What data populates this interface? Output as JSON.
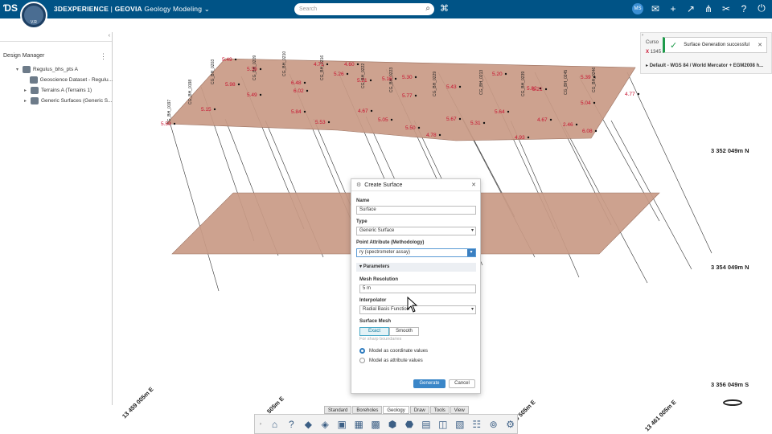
{
  "topbar": {
    "brand": "3DEXPERIENCE",
    "separator": " | ",
    "product": "GEOVIA",
    "app_name": "Geology Modeling",
    "search_placeholder": "Search",
    "compass_label": "V.R",
    "avatar_initials": "MS"
  },
  "left_panel": {
    "title": "Design Manager",
    "tree": [
      {
        "label": "Regulus_bhs_pts A"
      },
      {
        "label": "Geoscience Dataset - Regulu..."
      },
      {
        "label": "Terrains A (Terrains 1)"
      },
      {
        "label": "Generic Surfaces (Generic S..."
      }
    ]
  },
  "notifications": {
    "row1": "Curso",
    "row2_prefix": "X",
    "row2": "1345",
    "crs": "Default - WGS 84 / World Mercator + EGM2008 h...",
    "toast": "Surface Generation successful"
  },
  "dialog": {
    "title": "Create Surface",
    "name_label": "Name",
    "name_value": "Surface",
    "type_label": "Type",
    "type_value": "Generic Surface",
    "attr_label": "Point Attribute (Methodology)",
    "attr_value": "ry (spectrometer assay)",
    "params_label": "Parameters",
    "mesh_label": "Mesh Resolution",
    "mesh_value": "5 m",
    "interp_label": "Interpolator",
    "interp_value": "Radial Basis Function",
    "surface_mesh_label": "Surface Mesh",
    "seg_exact": "Exact",
    "seg_smooth": "Smooth",
    "hint": "For sharp boundaries",
    "radio1": "Model as coordinate values",
    "radio2": "Model as attribute values",
    "generate": "Generate",
    "cancel": "Cancel"
  },
  "tabs": [
    "Standard",
    "Boreholes",
    "Geology",
    "Draw",
    "Tools",
    "View"
  ],
  "active_tab": "Geology",
  "coords": {
    "n1": "3 352 049m N",
    "n2": "3 354 049m N",
    "s1": "3 356 049m S",
    "e1": "13 459 005m E",
    "e2": "13 460 505m E",
    "e3": "13 461 005m E",
    "e_partial": "505m E"
  },
  "borehole_labels": [
    "CG_BH_0197",
    "CG_BH_0198",
    "CG_BH_0203",
    "CG_BH_0209",
    "CG_BH_0210",
    "CG_BH_0216",
    "CG_BH_0222",
    "CG_BH_0223",
    "CG_BH_0229",
    "CG_BH_0213",
    "CG_BH_0239",
    "CG_BH_0245",
    "CG_BH_0246"
  ],
  "values": [
    {
      "v": "5.49"
    },
    {
      "v": "5.39"
    },
    {
      "v": "6.48"
    },
    {
      "v": "4.71"
    },
    {
      "v": "4.60"
    },
    {
      "v": "5.21"
    },
    {
      "v": "5.30"
    },
    {
      "v": "5.20"
    },
    {
      "v": "5.82"
    },
    {
      "v": "5.39"
    },
    {
      "v": "5.98"
    },
    {
      "v": "5.49"
    },
    {
      "v": "6.02"
    },
    {
      "v": "5.26"
    },
    {
      "v": "5.16"
    },
    {
      "v": "5.77"
    },
    {
      "v": "5.43"
    },
    {
      "v": "5.21"
    },
    {
      "v": "5.04"
    },
    {
      "v": "4.77"
    },
    {
      "v": "5.15"
    },
    {
      "v": "5.84"
    },
    {
      "v": "4.67"
    },
    {
      "v": "5.05"
    },
    {
      "v": "5.67"
    },
    {
      "v": "5.64"
    },
    {
      "v": "4.67"
    },
    {
      "v": "5.59"
    },
    {
      "v": "5.53"
    },
    {
      "v": "5.50"
    },
    {
      "v": "5.31"
    },
    {
      "v": "2.46"
    },
    {
      "v": "6.08"
    },
    {
      "v": "4.78"
    },
    {
      "v": "4.93"
    }
  ],
  "colors": {
    "topbar": "#005386",
    "surface": "#c99a85",
    "accent": "#3a86c8",
    "success": "#1e9b4b",
    "value_text": "#c8102e"
  }
}
